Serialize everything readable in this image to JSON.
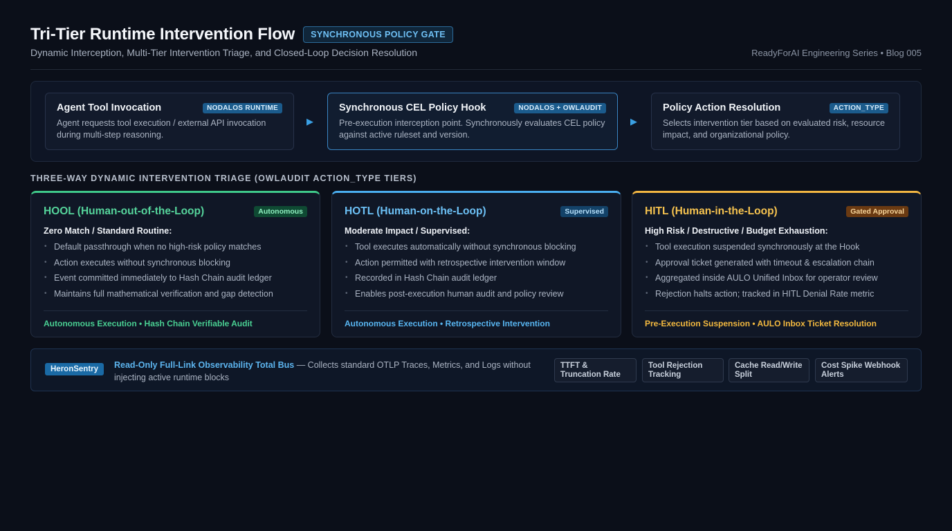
{
  "header": {
    "title": "Tri-Tier Runtime Intervention Flow",
    "badge": "SYNCHRONOUS POLICY GATE",
    "subtitle": "Dynamic Interception, Multi-Tier Intervention Triage, and Closed-Loop Decision Resolution",
    "series": "ReadyForAI Engineering Series • Blog 005"
  },
  "flow": {
    "steps": [
      {
        "name": "Agent Tool Invocation",
        "tag": "NODALOS RUNTIME",
        "desc": "Agent requests tool execution / external API invocation during multi-step reasoning."
      },
      {
        "name": "Synchronous CEL Policy Hook",
        "tag": "NODALOS + OWLAUDIT",
        "desc": "Pre-execution interception point. Synchronously evaluates CEL policy against active ruleset and version."
      },
      {
        "name": "Policy Action Resolution",
        "tag": "ACTION_TYPE",
        "desc": "Selects intervention tier based on evaluated risk, resource impact, and organizational policy."
      }
    ],
    "arrow": "▶"
  },
  "triage": {
    "label": "THREE-WAY DYNAMIC INTERVENTION TRIAGE (OWLAUDIT ACTION_TYPE TIERS)",
    "tiers": [
      {
        "name": "HOOL (Human-out-of-the-Loop)",
        "badge": "Autonomous",
        "condition": "Zero Match / Standard Routine:",
        "items": [
          "Default passthrough when no high-risk policy matches",
          "Action executes without synchronous blocking",
          "Event committed immediately to Hash Chain audit ledger",
          "Maintains full mathematical verification and gap detection"
        ],
        "footer": "Autonomous Execution • Hash Chain Verifiable Audit",
        "color": "#3fc98a"
      },
      {
        "name": "HOTL (Human-on-the-Loop)",
        "badge": "Supervised",
        "condition": "Moderate Impact / Supervised:",
        "items": [
          "Tool executes automatically without synchronous blocking",
          "Action permitted with retrospective intervention window",
          "Recorded in Hash Chain audit ledger",
          "Enables post-execution human audit and policy review"
        ],
        "footer": "Autonomous Execution • Retrospective Intervention",
        "color": "#4aaef0"
      },
      {
        "name": "HITL (Human-in-the-Loop)",
        "badge": "Gated Approval",
        "condition": "High Risk / Destructive / Budget Exhaustion:",
        "items": [
          "Tool execution suspended synchronously at the Hook",
          "Approval ticket generated with timeout & escalation chain",
          "Aggregated inside AULO Unified Inbox for operator review",
          "Rejection halts action; tracked in HITL Denial Rate metric"
        ],
        "footer": "Pre-Execution Suspension • AULO Inbox Ticket Resolution",
        "color": "#f2b642"
      }
    ]
  },
  "bus": {
    "brand": "HeronSentry",
    "title": "Read-Only Full-Link Observability Total Bus",
    "desc": " — Collects standard OTLP Traces, Metrics, and Logs without injecting active runtime blocks",
    "metrics": [
      [
        "TTFT &",
        "Truncation Rate"
      ],
      [
        "Tool Rejection",
        "Tracking"
      ],
      [
        "Cache Read/Write",
        "Split"
      ],
      [
        "Cost Spike Webhook",
        "Alerts"
      ]
    ]
  }
}
